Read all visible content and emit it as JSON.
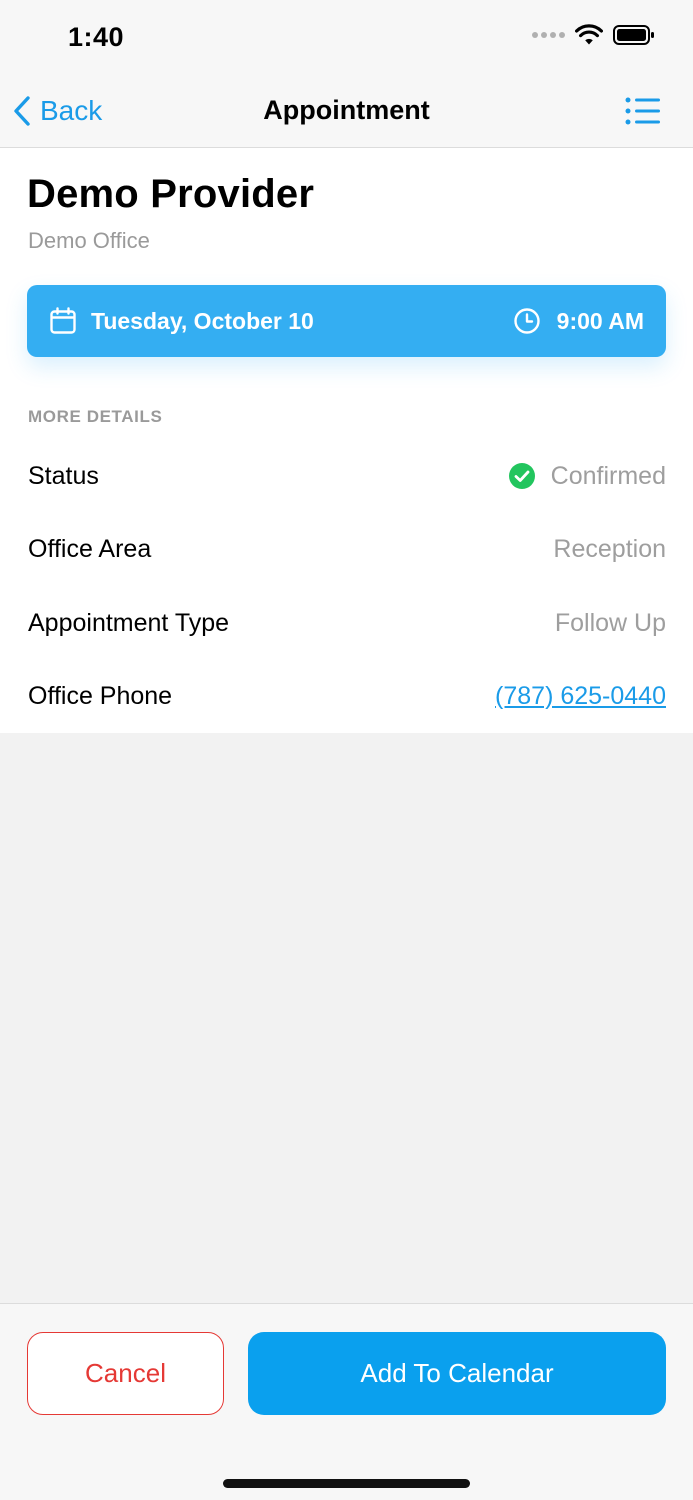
{
  "status_bar": {
    "time": "1:40"
  },
  "nav": {
    "back_label": "Back",
    "title": "Appointment",
    "back_icon": "chevron-left-icon",
    "menu_icon": "list-icon"
  },
  "provider": {
    "name": "Demo Provider",
    "office": "Demo Office"
  },
  "appointment": {
    "date": "Tuesday, October 10",
    "time": "9:00 AM",
    "card_color": "#34aef2"
  },
  "details": {
    "section_label": "MORE DETAILS",
    "rows": [
      {
        "label": "Status",
        "value": "Confirmed",
        "icon": "check-circle-icon",
        "icon_color": "#22c55e"
      },
      {
        "label": "Office Area",
        "value": "Reception"
      },
      {
        "label": "Appointment Type",
        "value": "Follow Up"
      },
      {
        "label": "Office Phone",
        "value": "(787) 625-0440",
        "link_color": "#1a9be8"
      }
    ]
  },
  "actions": {
    "cancel_label": "Cancel",
    "add_label": "Add To Calendar",
    "cancel_color": "#e53935",
    "add_color": "#0aa0ee"
  }
}
